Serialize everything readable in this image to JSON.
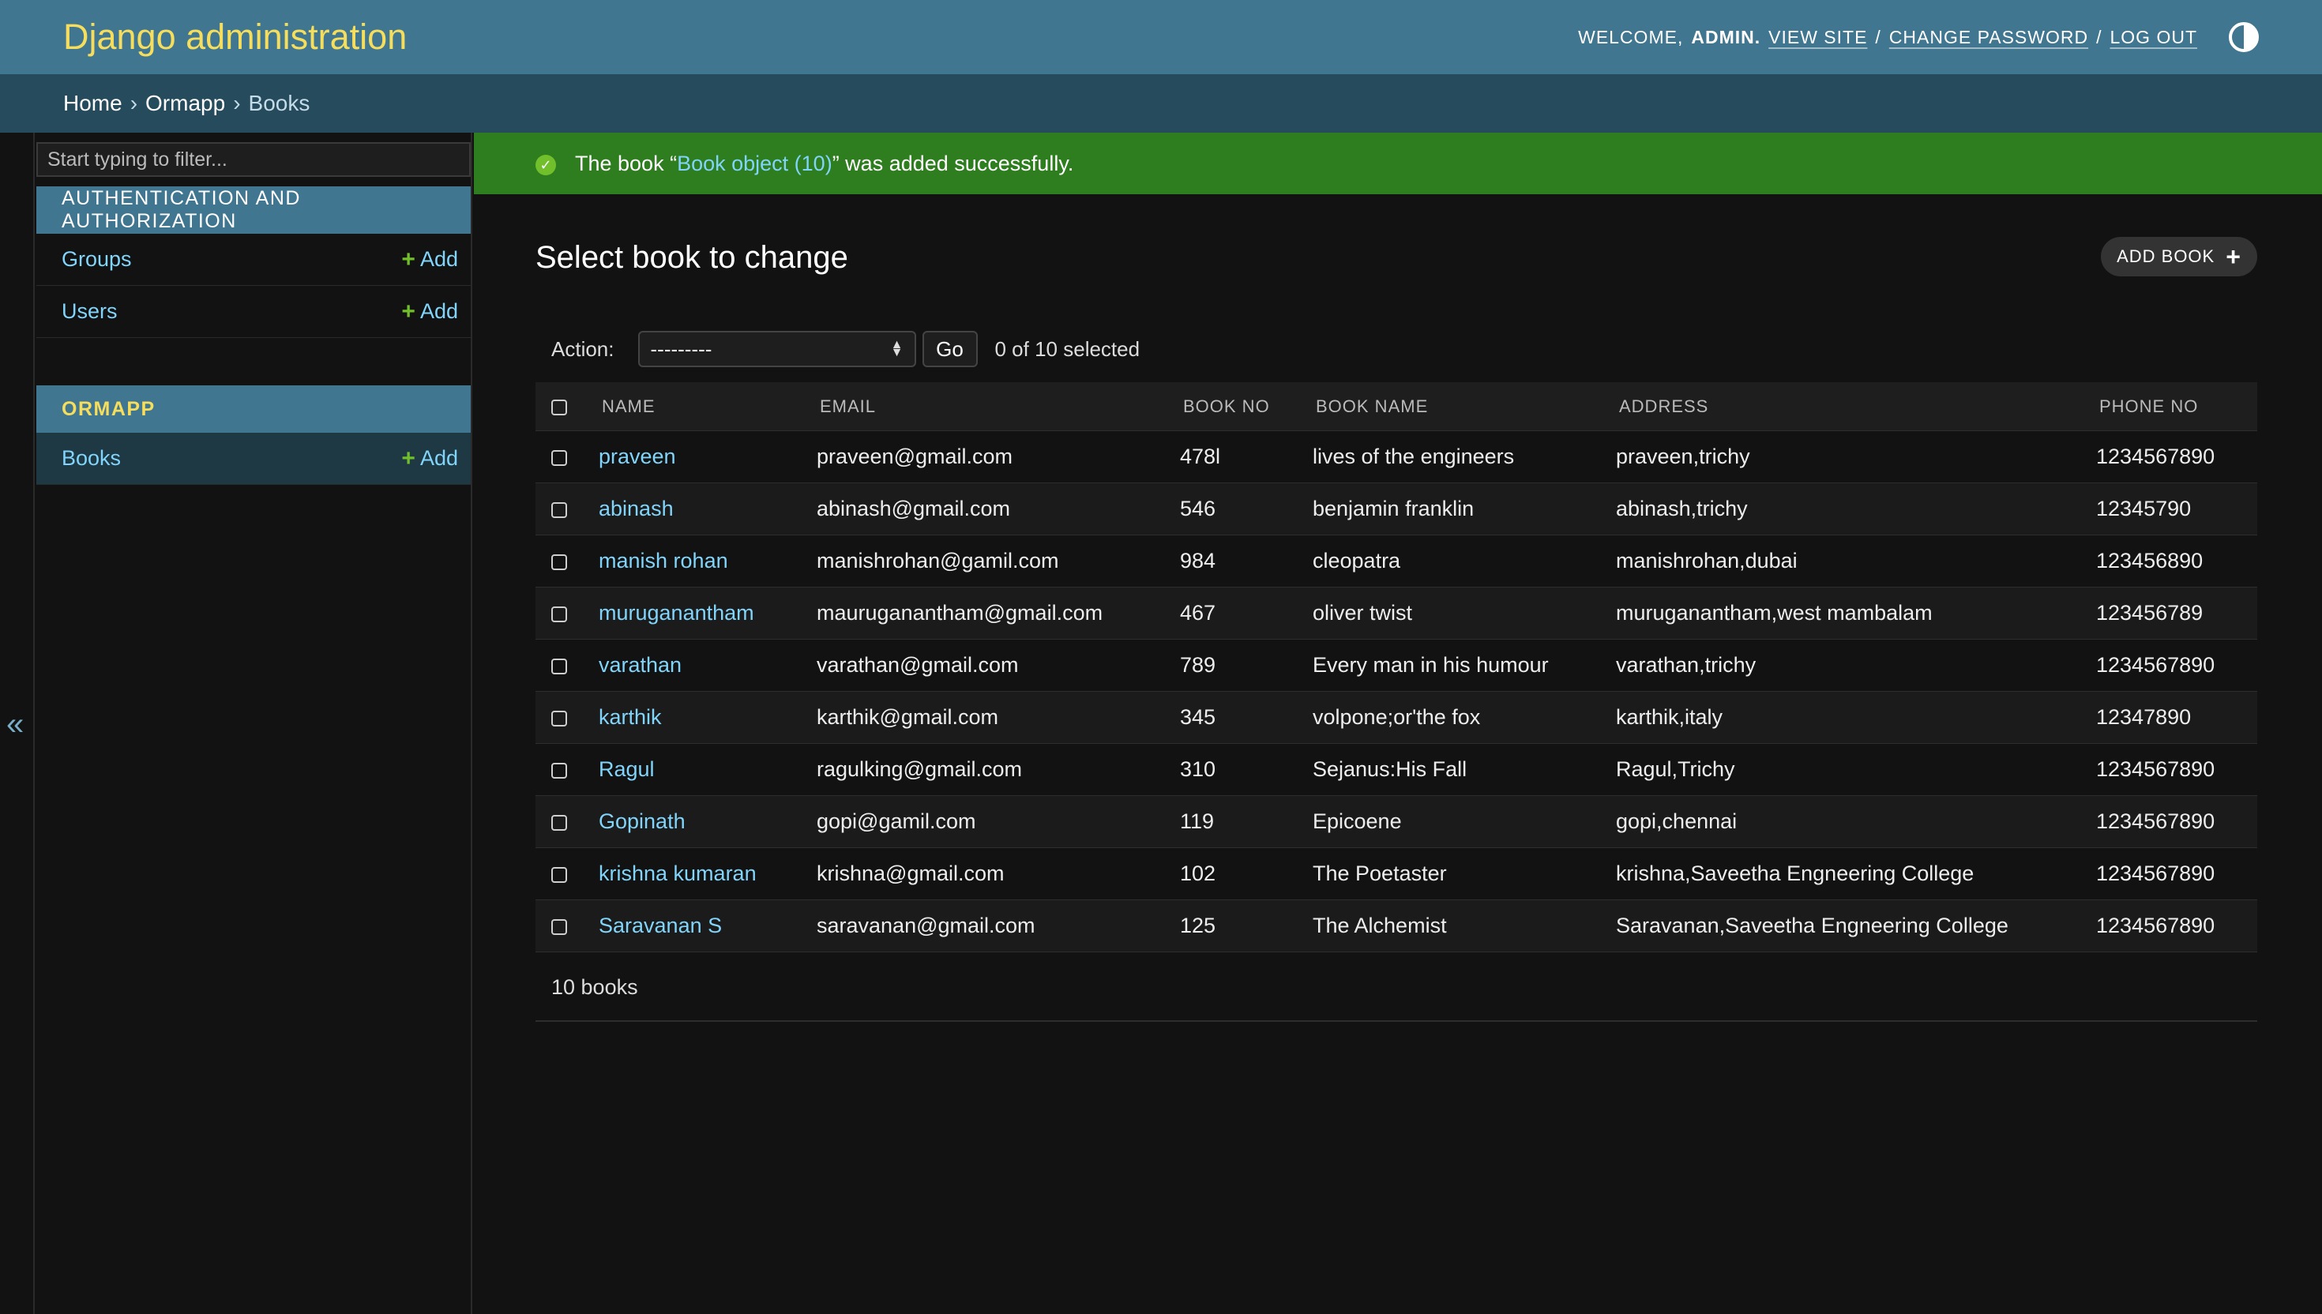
{
  "header": {
    "brand": "Django administration",
    "welcome": "WELCOME,",
    "username": "ADMIN.",
    "view_site": "VIEW SITE",
    "change_password": "CHANGE PASSWORD",
    "log_out": "LOG OUT",
    "sep": "/"
  },
  "breadcrumbs": {
    "home": "Home",
    "app": "Ormapp",
    "current": "Books",
    "sep": "›"
  },
  "sidebar": {
    "filter_placeholder": "Start typing to filter...",
    "apps": [
      {
        "caption": "AUTHENTICATION AND AUTHORIZATION",
        "models": [
          {
            "name": "Groups",
            "add": "Add"
          },
          {
            "name": "Users",
            "add": "Add"
          }
        ]
      },
      {
        "caption": "ORMAPP",
        "models": [
          {
            "name": "Books",
            "add": "Add"
          }
        ]
      }
    ],
    "collapse_glyph": "«"
  },
  "message": {
    "prefix": "The book “",
    "link": "Book object (10)",
    "suffix": "” was added successfully."
  },
  "content": {
    "title": "Select book to change",
    "add_button": "ADD BOOK",
    "action_label": "Action:",
    "action_value": "---------",
    "go": "Go",
    "selection": "0 of 10 selected",
    "columns": [
      "NAME",
      "EMAIL",
      "BOOK NO",
      "BOOK NAME",
      "ADDRESS",
      "PHONE NO"
    ],
    "rows": [
      [
        "praveen",
        "praveen@gmail.com",
        "478l",
        "lives of the engineers",
        "praveen,trichy",
        "1234567890"
      ],
      [
        "abinash",
        "abinash@gmail.com",
        "546",
        "benjamin franklin",
        "abinash,trichy",
        "12345790"
      ],
      [
        "manish rohan",
        "manishrohan@gamil.com",
        "984",
        "cleopatra",
        "manishrohan,dubai",
        "123456890"
      ],
      [
        "muruganantham",
        "mauruganantham@gmail.com",
        "467",
        "oliver twist",
        "muruganantham,west mambalam",
        "123456789"
      ],
      [
        "varathan",
        "varathan@gmail.com",
        "789",
        "Every man in his humour",
        "varathan,trichy",
        "1234567890"
      ],
      [
        "karthik",
        "karthik@gmail.com",
        "345",
        "volpone;or'the fox",
        "karthik,italy",
        "12347890"
      ],
      [
        "Ragul",
        "ragulking@gmail.com",
        "310",
        "Sejanus:His Fall",
        "Ragul,Trichy",
        "1234567890"
      ],
      [
        "Gopinath",
        "gopi@gamil.com",
        "119",
        "Epicoene",
        "gopi,chennai",
        "1234567890"
      ],
      [
        "krishna kumaran",
        "krishna@gmail.com",
        "102",
        "The Poetaster",
        "krishna,Saveetha Engneering College",
        "1234567890"
      ],
      [
        "Saravanan S",
        "saravanan@gmail.com",
        "125",
        "The Alchemist",
        "Saravanan,Saveetha Engneering College",
        "1234567890"
      ]
    ],
    "paginator": "10 books"
  },
  "colors": {
    "header_bg": "#417690",
    "brand": "#f5dd5d",
    "breadcrumbs_bg": "#264b5d",
    "success_bg": "#2e7d1e",
    "link": "#81d4fa",
    "add_plus": "#70bf2b"
  }
}
